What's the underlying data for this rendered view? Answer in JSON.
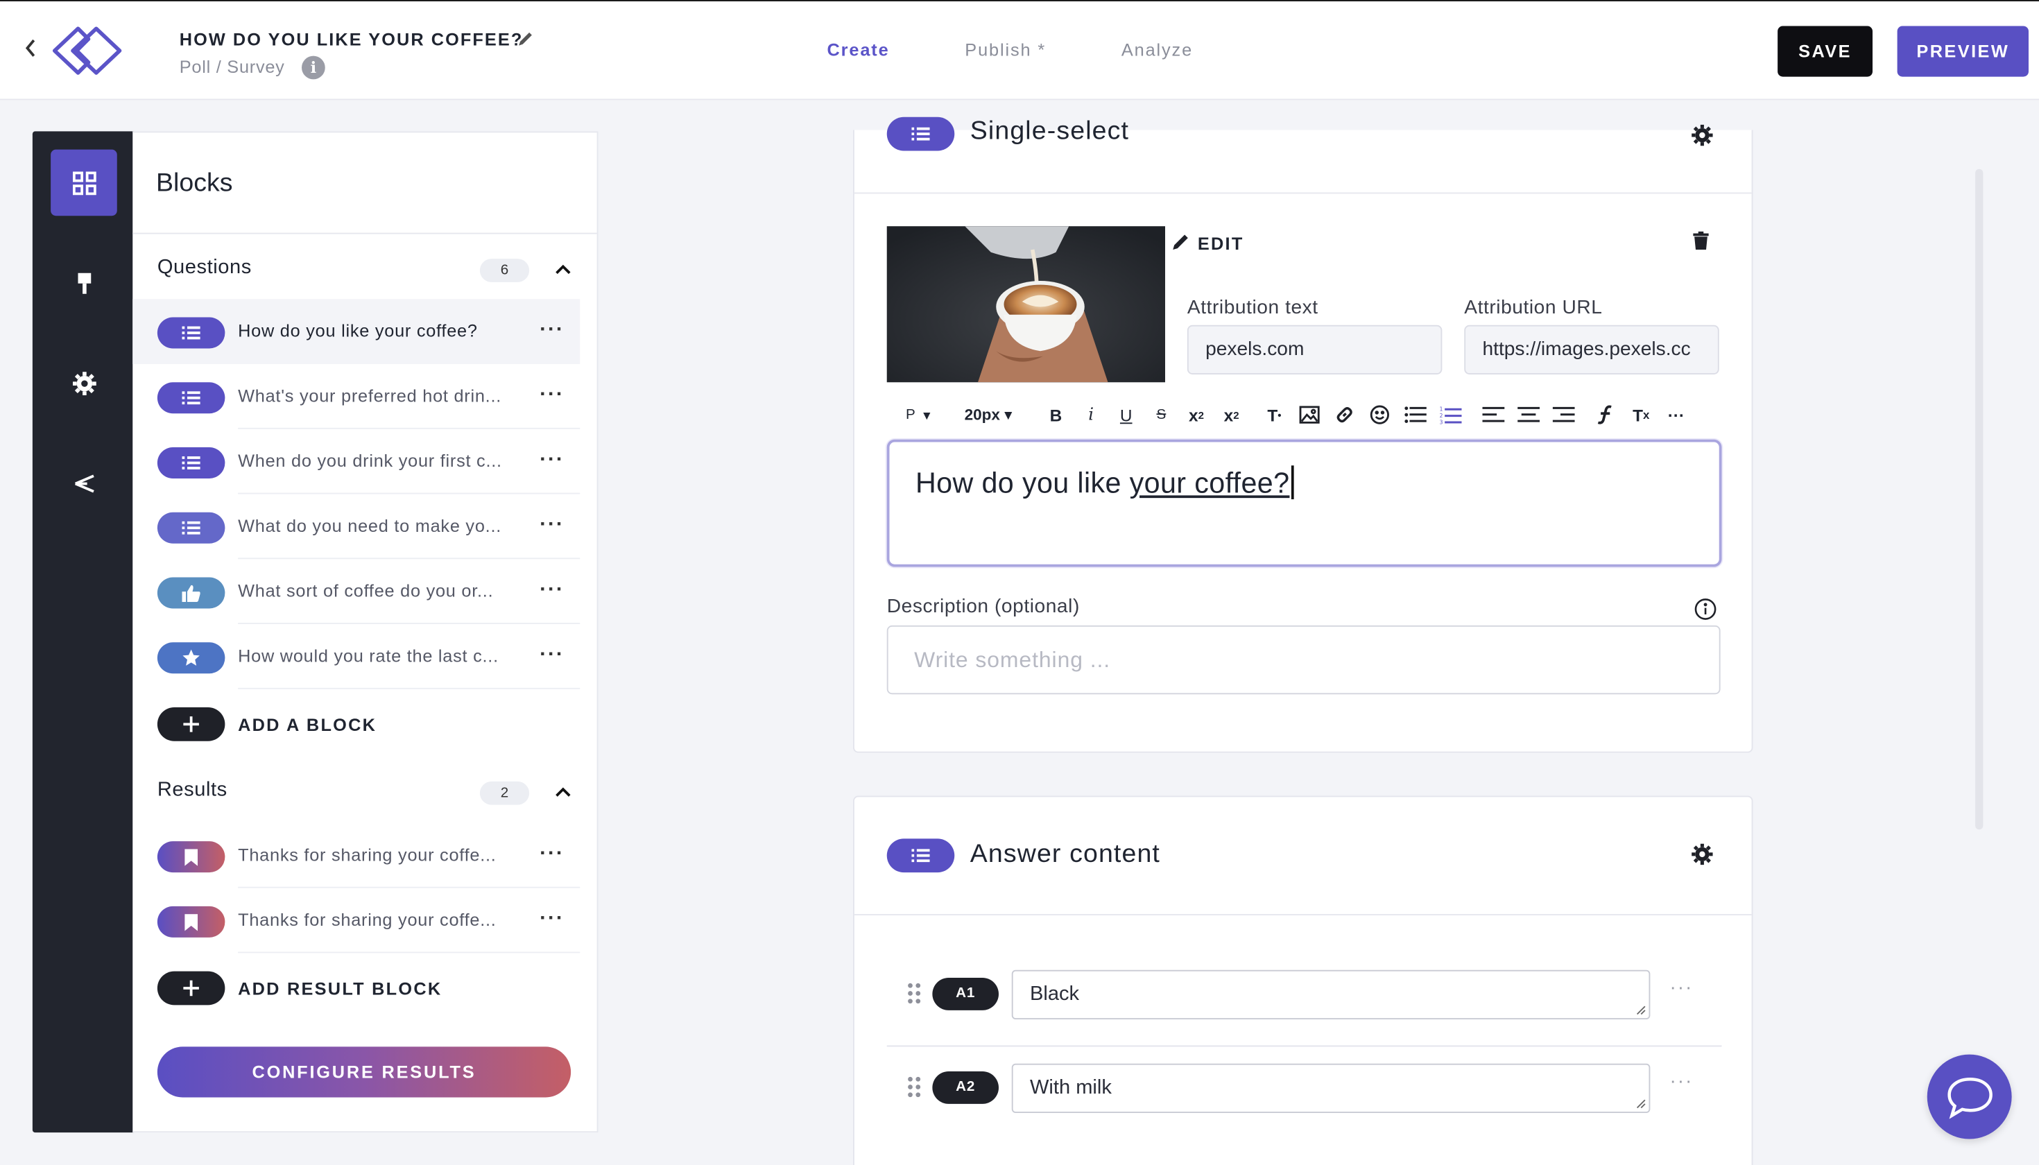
{
  "header": {
    "title": "HOW DO YOU LIKE YOUR COFFEE?",
    "subtitle": "Poll / Survey",
    "tabs": [
      {
        "label": "Create"
      },
      {
        "label": "Publish *"
      },
      {
        "label": "Analyze"
      }
    ],
    "save_label": "SAVE",
    "preview_label": "PREVIEW"
  },
  "panel": {
    "title": "Blocks",
    "questions": {
      "label": "Questions",
      "count": "6",
      "items": [
        {
          "label": "How do you like your coffee?",
          "icon": "list-icon"
        },
        {
          "label": "What's your preferred hot drin...",
          "icon": "list-icon"
        },
        {
          "label": "When do you drink your first c...",
          "icon": "list-icon"
        },
        {
          "label": "What do you need to make yo...",
          "icon": "list-icon"
        },
        {
          "label": "What sort of coffee do you or...",
          "icon": "thumbs-up-icon"
        },
        {
          "label": "How would you rate the last c...",
          "icon": "star-icon"
        }
      ],
      "add_label": "ADD A BLOCK"
    },
    "results": {
      "label": "Results",
      "count": "2",
      "items": [
        {
          "label": "Thanks for sharing your coffe...",
          "icon": "bookmark-icon"
        },
        {
          "label": "Thanks for sharing your coffe...",
          "icon": "bookmark-icon"
        }
      ],
      "add_label": "ADD RESULT BLOCK"
    },
    "configure_label": "CONFIGURE RESULTS"
  },
  "question_card": {
    "title": "Single-select",
    "edit_label": "EDIT",
    "attribution_text_label": "Attribution text",
    "attribution_text_value": "pexels.com",
    "attribution_url_label": "Attribution URL",
    "attribution_url_value": "https://images.pexels.cc",
    "toolbar": {
      "paragraph": "P",
      "font_size": "20px"
    },
    "question_text_plain": "How do you like ",
    "question_text_underlined": "your coffee?",
    "description_label": "Description (optional)",
    "description_placeholder": "Write something ..."
  },
  "answer_card": {
    "title": "Answer content",
    "answers": [
      {
        "badge": "A1",
        "value": "Black"
      },
      {
        "badge": "A2",
        "value": "With milk"
      }
    ]
  },
  "colors": {
    "accent": "#5950c3",
    "dark": "#22252e",
    "teal_pill": "#5a8fc0",
    "star_pill": "#4d74c4"
  }
}
